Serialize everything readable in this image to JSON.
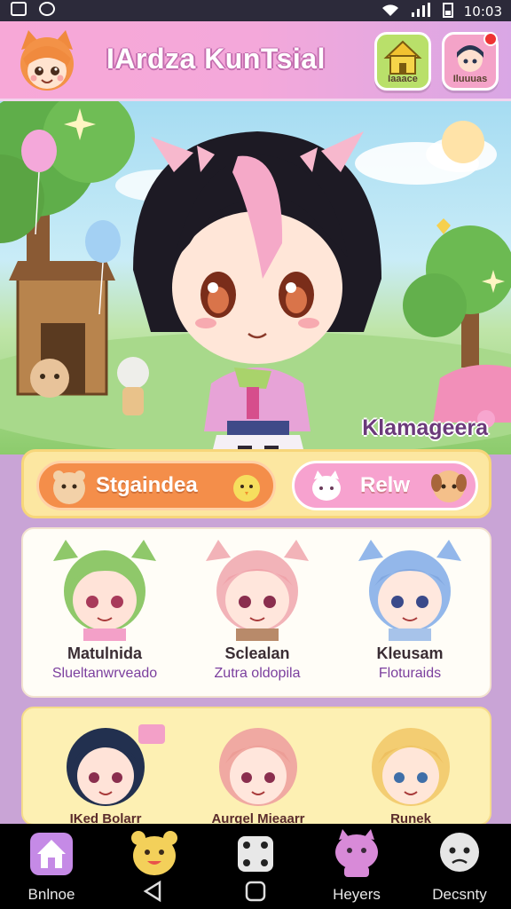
{
  "status_bar": {
    "time": "10:03"
  },
  "header": {
    "title": "IArdza KunTsial",
    "home_label": "Iaaace",
    "profile_label": "Iluuuas"
  },
  "hero": {
    "character_name": "Klamageera"
  },
  "actions": {
    "primary_label": "Stgaindea",
    "secondary_label": "Relw"
  },
  "characters": [
    {
      "name": "Matulnida",
      "subtitle": "Slueltanwrveado",
      "hair": "#8fc86a"
    },
    {
      "name": "Sclealan",
      "subtitle": "Zutra oldopila",
      "hair": "#f2b3b8"
    },
    {
      "name": "Kleusam",
      "subtitle": "Floturaids",
      "hair": "#93b7ea"
    }
  ],
  "characters_row2": [
    {
      "name": "IKed Bolarr",
      "hair": "#22304f"
    },
    {
      "name": "Aurgel Mieaarr",
      "hair": "#f0a9a2"
    },
    {
      "name": "Runek",
      "hair": "#f3cd72"
    }
  ],
  "nav": [
    {
      "label": "Bnlnoe",
      "icon": "home-icon"
    },
    {
      "label": "",
      "icon": "bear-face-icon"
    },
    {
      "label": "",
      "icon": "dice-icon"
    },
    {
      "label": "Heyers",
      "icon": "cat-mascot-icon"
    },
    {
      "label": "Decsnty",
      "icon": "ghost-face-icon"
    }
  ],
  "colors": {
    "accent_pink": "#f4a8da",
    "accent_orange": "#f48e4a",
    "card_yellow": "#fce7a1",
    "lilac": "#c9a4d6"
  }
}
